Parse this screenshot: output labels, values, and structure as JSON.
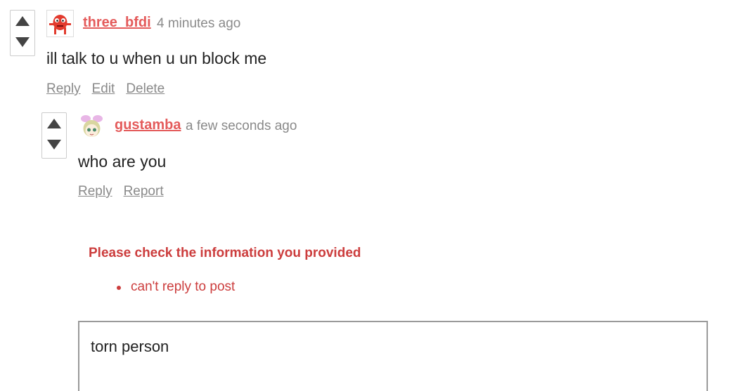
{
  "comments": [
    {
      "username": "three_bfdi",
      "timestamp": "4 minutes ago",
      "text": "ill talk to u when u un block me",
      "actions": [
        "Reply",
        "Edit",
        "Delete"
      ]
    },
    {
      "username": "gustamba",
      "timestamp": "a few seconds ago",
      "text": "who are you",
      "actions": [
        "Reply",
        "Report"
      ]
    }
  ],
  "error": {
    "title": "Please check the information you provided",
    "items": [
      "can't reply to post"
    ]
  },
  "reply_box": {
    "value": "torn person"
  },
  "colors": {
    "username": "#e45b5b",
    "error": "#cc3d3d",
    "muted": "#8a8a8a",
    "vote_arrow": "#444444"
  },
  "icons": {
    "upvote": "triangle-up-icon",
    "downvote": "triangle-down-icon"
  }
}
